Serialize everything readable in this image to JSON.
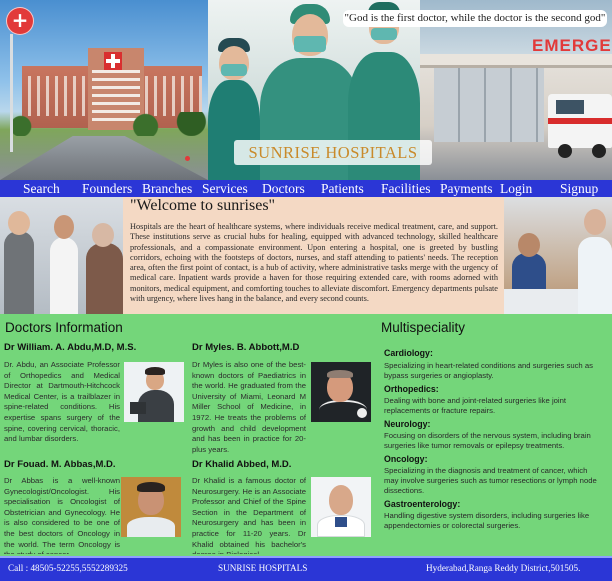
{
  "banner": {
    "quote": "\"God is the first doctor, while the doctor is the second god\"",
    "brand": "SUNRISE HOSPITALS",
    "er_sign": "EMERGE",
    "plus_label": "+"
  },
  "nav": {
    "items": [
      "Search",
      "Founders",
      "Branches",
      "Services",
      "Doctors",
      "Patients",
      "Facilities",
      "Payments",
      "Login",
      "Signup"
    ]
  },
  "welcome": {
    "title": "\"Welcome to sunrises\"",
    "text": "Hospitals are the heart of healthcare systems, where individuals receive medical treatment, care, and support. These institutions serve as crucial hubs for healing, equipped with advanced technology, skilled healthcare professionals, and a compassionate environment. Upon entering a hospital, one is greeted by bustling corridors, echoing with the footsteps of doctors, nurses, and staff attending to patients' needs. The reception area, often the first point of contact, is a hub of activity, where administrative tasks merge with the urgency of medical care. Inpatient wards provide a haven for those requiring extended care, with rooms adorned with monitors, medical equipment, and comforting touches to alleviate discomfort. Emergency departments pulsate with urgency, where lives hang in the balance, and every second counts."
  },
  "doctors": {
    "title": "Doctors Information",
    "items": [
      {
        "name": "Dr William. A. Abdu,M.D, M.S.",
        "bio": "Dr. Abdu, an Associate Professor of Orthopedics and Medical Director at Dartmouth-Hitchcock Medical Center, is a trailblazer in spine-related conditions. His expertise spans surgery of the spine, covering cervical, thoracic, and lumbar disorders."
      },
      {
        "name": "Dr Myles. B. Abbott,M.D",
        "bio": "Dr Myles is also one of the best-known doctors of Paediatrics in the world. He graduated from the University of Miami, Leonard M Miller School of Medicine, in 1972. He treats the problems of growth and child development and has been in practice for 20-plus years."
      },
      {
        "name": "Dr Fouad. M. Abbas,M.D.",
        "bio": "Dr Abbas is a well-known Gynecologist/Oncologist. His specialisation is Oncologist of Obstetrician and Gynecology. He is also considered to be one of the best doctors of Oncology in the world. The term Oncology is the study of cancer."
      },
      {
        "name": "Dr Khalid Abbed, M.D.",
        "bio": "Dr Khalid is a famous doctor of Neurosurgery. He is an Associate Professor and Chief of the Spine Section in the Department of Neurosurgery and has been in practice for 11-20 years. Dr Khalid obtained his bachelor's degree in Biological"
      }
    ]
  },
  "multispeciality": {
    "title": "Multispeciality",
    "items": [
      {
        "name": "Cardiology:",
        "desc": "Specializing in heart-related conditions and surgeries such as bypass surgeries or angioplasty."
      },
      {
        "name": "Orthopedics:",
        "desc": "Dealing with bone and joint-related surgeries like joint replacements or fracture repairs."
      },
      {
        "name": "Neurology:",
        "desc": "Focusing on disorders of the nervous system, including brain surgeries like tumor removals or epilepsy treatments."
      },
      {
        "name": "Oncology:",
        "desc": "Specializing in the diagnosis and treatment of cancer, which may involve surgeries such as tumor resections or lymph node dissections."
      },
      {
        "name": "Gastroenterology:",
        "desc": "Handling digestive system disorders, including surgeries like appendectomies or colorectal surgeries."
      }
    ]
  },
  "footer": {
    "call": "Call : 48505-52255,5552289325",
    "brand": "SUNRISE HOSPITALS",
    "address": "Hyderabad,Ranga Reddy District,501505."
  },
  "colors": {
    "nav": "#2b36d6",
    "main_bg": "#74d67a",
    "welcome_bg": "#f4d9c4",
    "brand_text": "#c98a2a",
    "accent_red": "#e23a3a"
  }
}
